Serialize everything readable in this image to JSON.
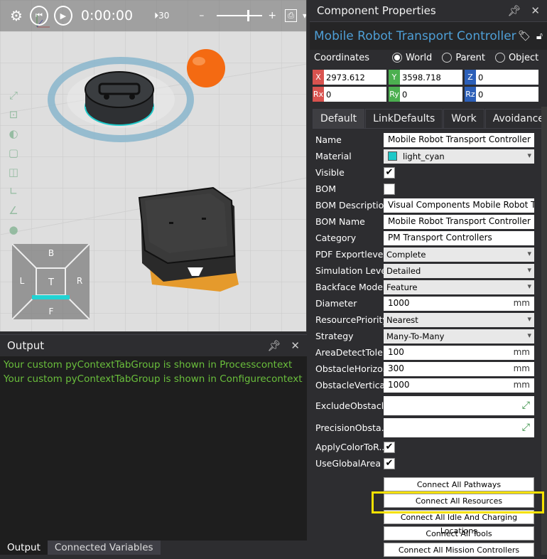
{
  "playbar": {
    "time": "0:00:00",
    "speed": "30"
  },
  "navcube": {
    "top": "B",
    "center": "T",
    "left": "L",
    "right": "R",
    "bottom": "F"
  },
  "output": {
    "title": "Output",
    "lines": [
      "Your custom pyContextTabGroup is shown in Processcontext",
      "Your custom pyContextTabGroup is shown in Configurecontext"
    ],
    "tabs": [
      "Output",
      "Connected Variables"
    ]
  },
  "props": {
    "title": "Component Properties",
    "component_name": "Mobile Robot Transport Controller",
    "coordinates_label": "Coordinates",
    "coord_options": [
      "World",
      "Parent",
      "Object"
    ],
    "selected_coord": "World",
    "x": "2973.612",
    "y": "3598.718",
    "z": "0",
    "rx": "0",
    "ry": "0",
    "rz": "0",
    "tabs": [
      "Default",
      "LinkDefaults",
      "Work",
      "Avoidance"
    ],
    "fields": {
      "name_label": "Name",
      "name": "Mobile Robot Transport Controller",
      "material_label": "Material",
      "material": "light_cyan",
      "visible_label": "Visible",
      "bom_label": "BOM",
      "bom_description_label": "BOM Description",
      "bom_description": "Visual Components Mobile Robot Tra",
      "bom_name_label": "BOM Name",
      "bom_name": "Mobile Robot Transport Controller",
      "category_label": "Category",
      "category": "PM Transport Controllers",
      "pdf_label": "PDF Exportlevel",
      "pdf": "Complete",
      "sim_label": "Simulation Level",
      "sim": "Detailed",
      "backface_label": "Backface Mode",
      "backface": "Feature",
      "diameter_label": "Diameter",
      "diameter": "1000",
      "unit_mm": "mm",
      "priority_label": "ResourcePriority",
      "priority": "Nearest",
      "strategy_label": "Strategy",
      "strategy": "Many-To-Many",
      "area_label": "AreaDetectTole...",
      "area": "100",
      "horiz_label": "ObstacleHorizo...",
      "horiz": "300",
      "vert_label": "ObstacleVertica...",
      "vert": "1000",
      "exclude_label": "ExcludeObstacles",
      "precision_label": "PrecisionObsta...",
      "applycolor_label": "ApplyColorToR...",
      "useglobal_label": "UseGlobalArea"
    },
    "buttons": [
      "Connect All Pathways",
      "Connect All Resources",
      "Connect All Idle And Charging Locations",
      "Connect All Tools",
      "Connect All Mission Controllers"
    ]
  }
}
